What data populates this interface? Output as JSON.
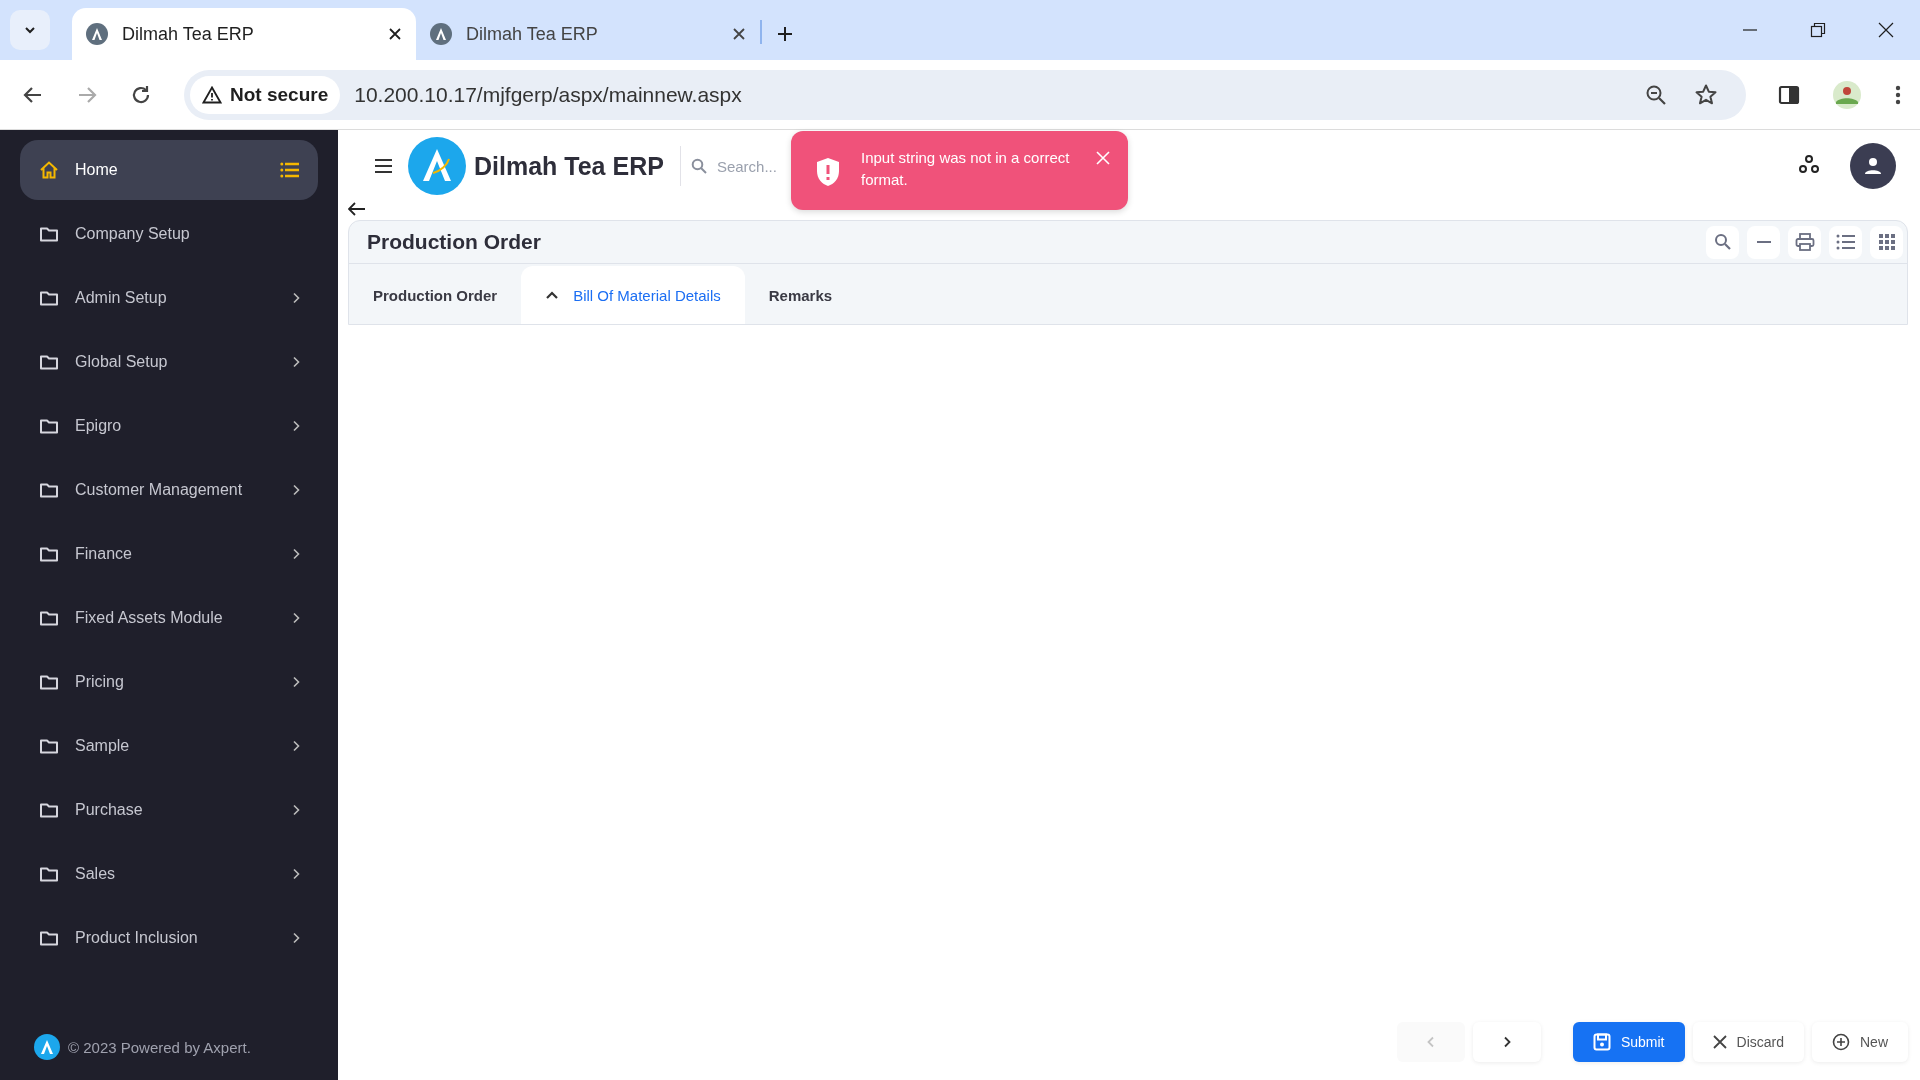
{
  "browser": {
    "tabs": [
      {
        "title": "Dilmah Tea ERP",
        "selected": true
      },
      {
        "title": "Dilmah Tea ERP",
        "selected": false
      }
    ],
    "security": "Not secure",
    "url": "10.200.10.17/mjfgerp/aspx/mainnew.aspx"
  },
  "sidebar": {
    "items": [
      {
        "label": "Home",
        "kind": "home",
        "selected": true,
        "has_children": false
      },
      {
        "label": "Company Setup",
        "kind": "folder",
        "selected": false,
        "has_children": false
      },
      {
        "label": "Admin Setup",
        "kind": "folder",
        "selected": false,
        "has_children": true
      },
      {
        "label": "Global Setup",
        "kind": "folder",
        "selected": false,
        "has_children": true
      },
      {
        "label": "Epigro",
        "kind": "folder",
        "selected": false,
        "has_children": true
      },
      {
        "label": "Customer Management",
        "kind": "folder",
        "selected": false,
        "has_children": true
      },
      {
        "label": "Finance",
        "kind": "folder",
        "selected": false,
        "has_children": true
      },
      {
        "label": "Fixed Assets Module",
        "kind": "folder",
        "selected": false,
        "has_children": true
      },
      {
        "label": "Pricing",
        "kind": "folder",
        "selected": false,
        "has_children": true
      },
      {
        "label": "Sample",
        "kind": "folder",
        "selected": false,
        "has_children": true
      },
      {
        "label": "Purchase",
        "kind": "folder",
        "selected": false,
        "has_children": true
      },
      {
        "label": "Sales",
        "kind": "folder",
        "selected": false,
        "has_children": true
      },
      {
        "label": "Product Inclusion",
        "kind": "folder",
        "selected": false,
        "has_children": true
      }
    ],
    "footer": "© 2023 Powered by Axpert."
  },
  "header": {
    "app_title": "Dilmah Tea ERP",
    "search": {
      "placeholder": "Search..."
    }
  },
  "toast": {
    "message": "Input string was not in a correct format."
  },
  "page": {
    "title": "Production Order",
    "tabs": [
      {
        "label": "Production Order",
        "selected": false
      },
      {
        "label": "Bill Of Material Details",
        "selected": true
      },
      {
        "label": "Remarks",
        "selected": false
      }
    ]
  },
  "footer_bar": {
    "nav": [
      {
        "kind": "prev",
        "disabled": true
      },
      {
        "kind": "next",
        "disabled": false
      }
    ],
    "buttons": [
      {
        "label": "Submit",
        "kind": "submit"
      },
      {
        "label": "Discard",
        "kind": "discard"
      },
      {
        "label": "New",
        "kind": "new"
      }
    ]
  }
}
